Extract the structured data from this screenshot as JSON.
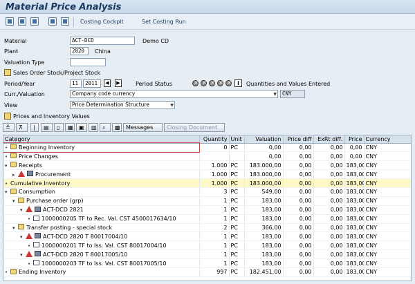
{
  "window": {
    "title": "Material Price Analysis"
  },
  "toolbar": {
    "icons": [
      "refresh-icon",
      "display-icon",
      "hierarchy-icon",
      "calculator-icon",
      "grid-icon"
    ],
    "costing_cockpit": "Costing Cockpit",
    "set_costing_run": "Set Costing Run"
  },
  "form": {
    "material_label": "Material",
    "material_value": "ACT-DCD",
    "material_desc": "Demo CD",
    "plant_label": "Plant",
    "plant_value": "2820",
    "plant_desc": "China",
    "valuation_type_label": "Valuation Type",
    "valuation_type_value": "",
    "sales_order_btn": "Sales Order Stock/Project Stock",
    "period_year_label": "Period/Year",
    "period_value": "11",
    "year_value": "2011",
    "period_status_label": "Period Status",
    "period_status_text": "Quantities and Values Entered",
    "curr_valuation_label": "Curr./Valuation",
    "curr_valuation_value": "Company code currency",
    "currency": "CNY",
    "view_label": "View",
    "view_value": "Price Determination Structure",
    "prices_inv_btn": "Prices and Inventory Values"
  },
  "grid_toolbar": {
    "messages_label": "Messages",
    "close_document_label": "Closing Document"
  },
  "grid": {
    "columns": [
      "Category",
      "Quantity",
      "Unit",
      "Valuation",
      "Price diff",
      "ExRt diff.",
      "Price",
      "Currency"
    ],
    "rows": [
      {
        "indent": 0,
        "caret": "•",
        "icon": "folder",
        "label": "Beginning Inventory",
        "qty": "0",
        "unit": "PC",
        "val": "0,00",
        "pdiff": "0,00",
        "exrt": "0,00",
        "price": "0,00",
        "curr": "CNY",
        "style": "outer"
      },
      {
        "indent": 0,
        "caret": "•",
        "icon": "folder",
        "label": "Price Changes",
        "qty": "",
        "unit": "",
        "val": "0,00",
        "pdiff": "0,00",
        "exrt": "0,00",
        "price": "0,00",
        "curr": "CNY",
        "style": ""
      },
      {
        "indent": 0,
        "caret": "▾",
        "icon": "folder",
        "label": "Receipts",
        "qty": "1.000",
        "unit": "PC",
        "val": "183.000,00",
        "pdiff": "0,00",
        "exrt": "0,00",
        "price": "183,00",
        "curr": "CNY",
        "style": ""
      },
      {
        "indent": 1,
        "caret": "▸",
        "icon": "tri",
        "label": "Procurement",
        "qty": "1.000",
        "unit": "PC",
        "val": "183.000,00",
        "pdiff": "0,00",
        "exrt": "0,00",
        "price": "183,00",
        "curr": "CNY",
        "style": ""
      },
      {
        "indent": 0,
        "caret": "•",
        "icon": "",
        "label": "Cumulative Inventory",
        "qty": "1.000",
        "unit": "PC",
        "val": "183.000,00",
        "pdiff": "0,00",
        "exrt": "0,00",
        "price": "183,00",
        "curr": "CNY",
        "style": "hl"
      },
      {
        "indent": 0,
        "caret": "▾",
        "icon": "folder",
        "label": "Consumption",
        "qty": "3",
        "unit": "PC",
        "val": "549,00",
        "pdiff": "0,00",
        "exrt": "0,00",
        "price": "183,00",
        "curr": "CNY",
        "style": ""
      },
      {
        "indent": 1,
        "caret": "▾",
        "icon": "folder",
        "label": "Purchase order (grp)",
        "qty": "1",
        "unit": "PC",
        "val": "183,00",
        "pdiff": "0,00",
        "exrt": "0,00",
        "price": "183,00",
        "curr": "CNY",
        "style": ""
      },
      {
        "indent": 2,
        "caret": "▾",
        "icon": "tri",
        "label": "ACT-DCD 2821",
        "qty": "1",
        "unit": "PC",
        "val": "183,00",
        "pdiff": "0,00",
        "exrt": "0,00",
        "price": "183,00",
        "curr": "CNY",
        "style": ""
      },
      {
        "indent": 3,
        "caret": "•",
        "icon": "doc",
        "label": "1000000205 TF to Rec. Val. CST 4500017634/10",
        "qty": "1",
        "unit": "PC",
        "val": "183,00",
        "pdiff": "0,00",
        "exrt": "0,00",
        "price": "183,00",
        "curr": "CNY",
        "style": ""
      },
      {
        "indent": 1,
        "caret": "▾",
        "icon": "folder",
        "label": "Transfer posting - special stock",
        "qty": "2",
        "unit": "PC",
        "val": "366,00",
        "pdiff": "0,00",
        "exrt": "0,00",
        "price": "183,00",
        "curr": "CNY",
        "style": ""
      },
      {
        "indent": 2,
        "caret": "▾",
        "icon": "tri",
        "label": "ACT-DCD 2820 T 80017004/10",
        "qty": "1",
        "unit": "PC",
        "val": "183,00",
        "pdiff": "0,00",
        "exrt": "0,00",
        "price": "183,00",
        "curr": "CNY",
        "style": ""
      },
      {
        "indent": 3,
        "caret": "•",
        "icon": "doc",
        "label": "1000000201 TF to Iss. Val. CST 80017004/10",
        "qty": "1",
        "unit": "PC",
        "val": "183,00",
        "pdiff": "0,00",
        "exrt": "0,00",
        "price": "183,00",
        "curr": "CNY",
        "style": ""
      },
      {
        "indent": 2,
        "caret": "▾",
        "icon": "tri",
        "label": "ACT-DCD 2820 T 80017005/10",
        "qty": "1",
        "unit": "PC",
        "val": "183,00",
        "pdiff": "0,00",
        "exrt": "0,00",
        "price": "183,00",
        "curr": "CNY",
        "style": ""
      },
      {
        "indent": 3,
        "caret": "•",
        "icon": "doc",
        "label": "1000000203 TF to Iss. Val. CST 80017005/10",
        "qty": "1",
        "unit": "PC",
        "val": "183,00",
        "pdiff": "0,00",
        "exrt": "0,00",
        "price": "183,00",
        "curr": "CNY",
        "style": ""
      },
      {
        "indent": 0,
        "caret": "•",
        "icon": "folder",
        "label": "Ending Inventory",
        "qty": "997",
        "unit": "PC",
        "val": "182.451,00",
        "pdiff": "0,00",
        "exrt": "0,00",
        "price": "183,00",
        "curr": "CNY",
        "style": ""
      }
    ]
  }
}
